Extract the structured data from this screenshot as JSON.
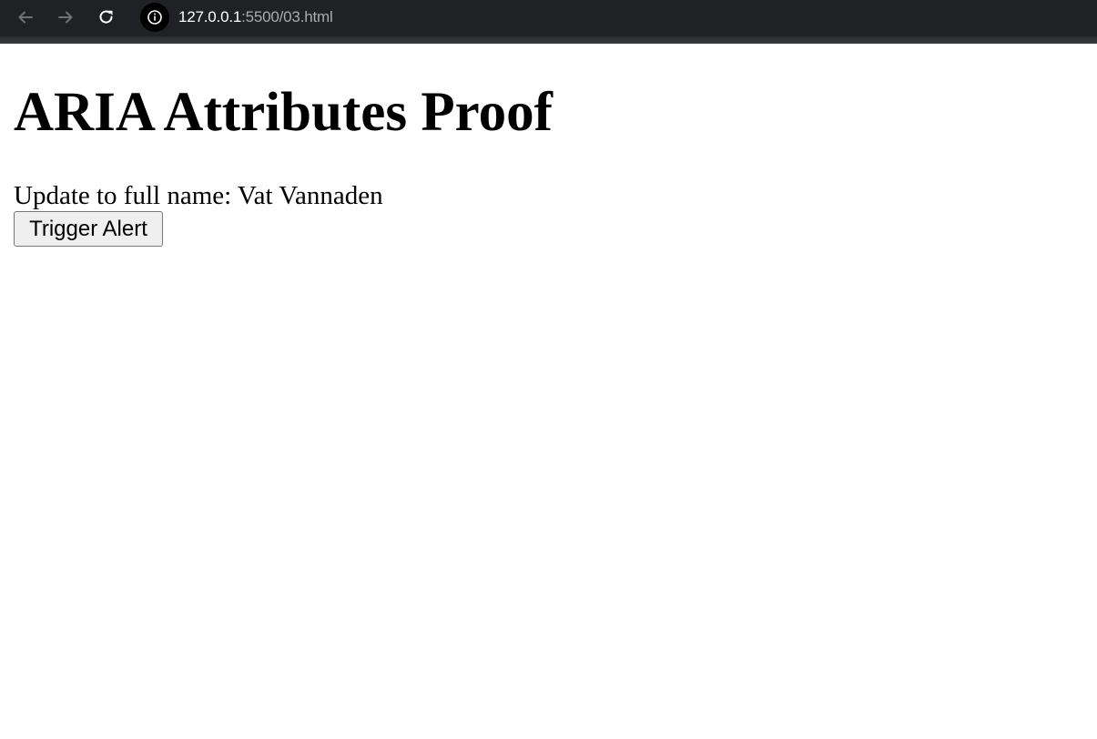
{
  "browser": {
    "url_host": "127.0.0.1",
    "url_path": ":5500/03.html",
    "icons": {
      "back": "arrow-left-icon",
      "forward": "arrow-right-icon",
      "reload": "reload-icon",
      "site_info": "info-icon"
    },
    "colors": {
      "toolbar": "#202124",
      "url_host": "#ffffff",
      "url_path": "#a8abb0"
    }
  },
  "page": {
    "title": "ARIA Attributes Proof",
    "status_text": "Update to full name: Vat Vannaden",
    "button_label": "Trigger Alert"
  }
}
